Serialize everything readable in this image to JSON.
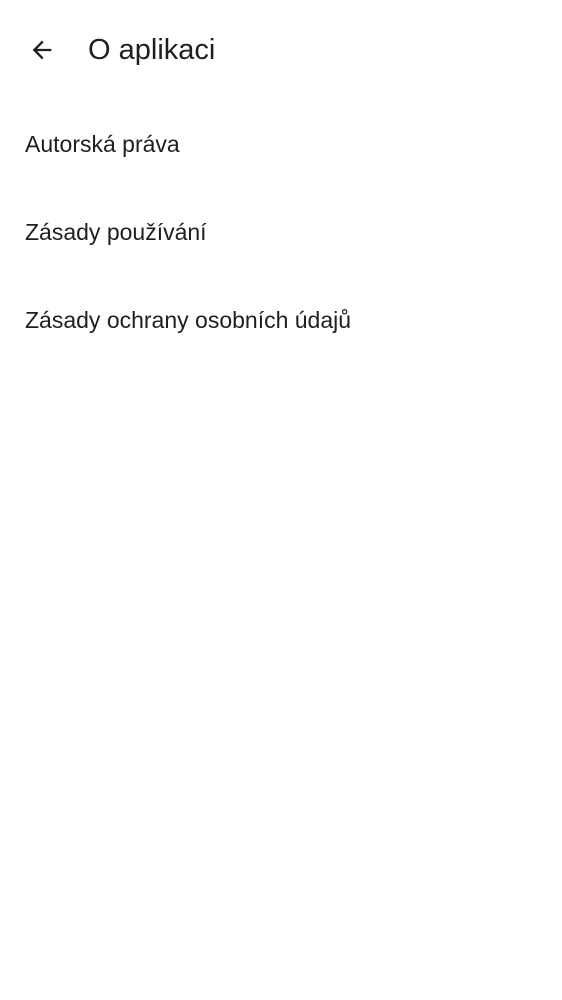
{
  "header": {
    "title": "O aplikaci",
    "back_icon": "arrow-back-icon"
  },
  "list": {
    "items": [
      {
        "label": "Autorská práva"
      },
      {
        "label": "Zásady používání"
      },
      {
        "label": "Zásady ochrany osobních údajů"
      }
    ]
  },
  "colors": {
    "background": "#ffffff",
    "text": "#1f1f1f"
  }
}
